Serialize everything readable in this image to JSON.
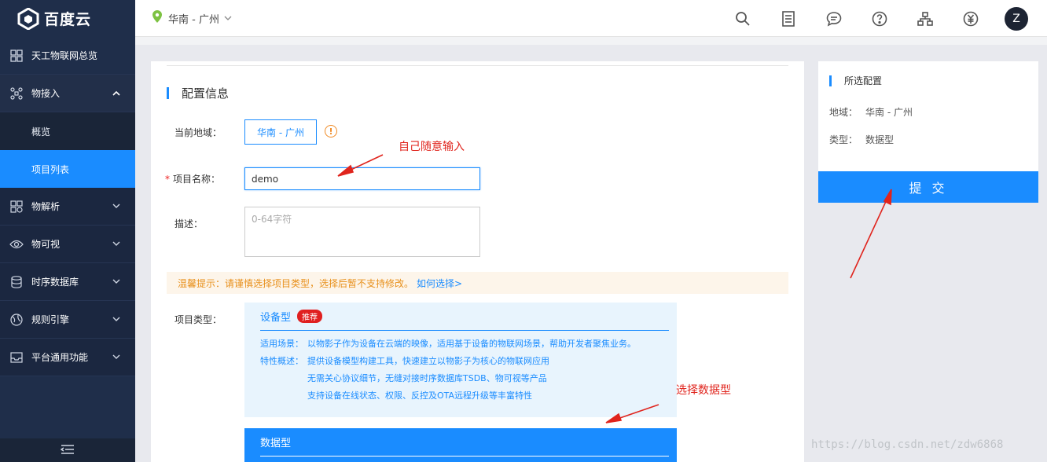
{
  "brand": {
    "name": "百度云"
  },
  "sidebar": {
    "overview": {
      "label": "天工物联网总览",
      "icon": "grid-icon"
    },
    "groups": [
      {
        "label": "物接入",
        "icon": "hub-icon",
        "expanded": true,
        "subitems": [
          {
            "label": "概览",
            "active": false
          },
          {
            "label": "项目列表",
            "active": true
          }
        ]
      },
      {
        "label": "物解析",
        "icon": "parse-icon"
      },
      {
        "label": "物可视",
        "icon": "eye-icon"
      },
      {
        "label": "时序数据库",
        "icon": "database-icon"
      },
      {
        "label": "规则引擎",
        "icon": "globe-icon"
      },
      {
        "label": "平台通用功能",
        "icon": "inbox-icon"
      }
    ],
    "footer_icon": "collapse-menu-icon"
  },
  "header": {
    "region": "华南 - 广州",
    "icons": [
      "search-icon",
      "list-icon",
      "message-icon",
      "help-icon",
      "sitemap-icon",
      "currency-icon"
    ],
    "avatar_letter": "Z"
  },
  "form": {
    "section_title": "配置信息",
    "region_label": "当前地域：",
    "region_value": "华南 - 广州",
    "name_label": "项目名称：",
    "name_value": "demo",
    "desc_label": "描述：",
    "desc_placeholder": "0-64字符",
    "tip_text": "温馨提示：请谨慎选择项目类型，选择后暂不支持修改。",
    "tip_link": "如何选择>",
    "type_label": "项目类型：",
    "types": [
      {
        "name": "设备型",
        "badge": "推荐",
        "scene_key": "适用场景：",
        "scene": "以物影子作为设备在云端的映像，适用基于设备的物联网场景，帮助开发者聚焦业务。",
        "feature_key": "特性概述：",
        "features": [
          "提供设备模型构建工具，快速建立以物影子为核心的物联网应用",
          "无需关心协议细节，无缝对接时序数据库TSDB、物可视等产品",
          "支持设备在线状态、权限、反控及OTA远程升级等丰富特性"
        ]
      },
      {
        "name": "数据型",
        "selected": true
      }
    ]
  },
  "summary": {
    "title": "所选配置",
    "region_key": "地域：",
    "region_value": "华南 - 广州",
    "type_key": "类型：",
    "type_value": "数据型",
    "submit_label": "提 交"
  },
  "annotations": {
    "name_hint": "自己随意输入",
    "type_hint": "选择数据型"
  },
  "watermark": "https://blog.csdn.net/zdw6868",
  "colors": {
    "accent": "#1a8cff",
    "sidebar": "#1f2e4a",
    "annotation": "#e0241d",
    "warning": "#e8901b"
  }
}
